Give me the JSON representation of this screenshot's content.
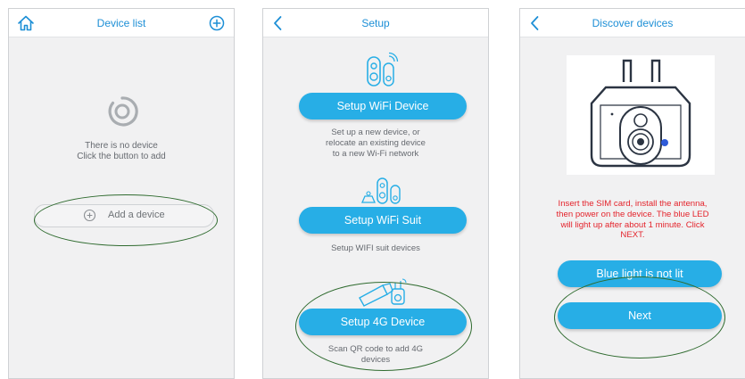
{
  "screen1": {
    "title": "Device list",
    "empty_line1": "There is no device",
    "empty_line2": "Click the button to add",
    "add_button": "Add a device"
  },
  "screen2": {
    "title": "Setup",
    "wifi_device_button": "Setup WiFi Device",
    "wifi_device_desc": [
      "Set up a new device, or",
      "relocate an existing device",
      "to a new Wi-Fi network"
    ],
    "wifi_suit_button": "Setup WiFi Suit",
    "wifi_suit_desc": "Setup WIFI suit devices",
    "device_4g_button": "Setup 4G Device",
    "device_4g_desc": [
      "Scan QR code to add 4G",
      "devices"
    ]
  },
  "screen3": {
    "title": "Discover devices",
    "instruction": [
      "Insert the SIM card, install the antenna,",
      "then power on the device. The blue LED",
      "will light up after about 1 minute. Click",
      "NEXT."
    ],
    "not_lit_button": "Blue light is not lit",
    "next_button": "Next"
  },
  "colors": {
    "accent": "#27aee6",
    "title_blue": "#1d8fd6",
    "instruction_red": "#e4242c",
    "highlight_green": "#2f6b2f"
  },
  "icons": {
    "screen1_left": "home-icon",
    "screen1_right": "add-circle-icon",
    "back": "chevron-left-icon"
  }
}
